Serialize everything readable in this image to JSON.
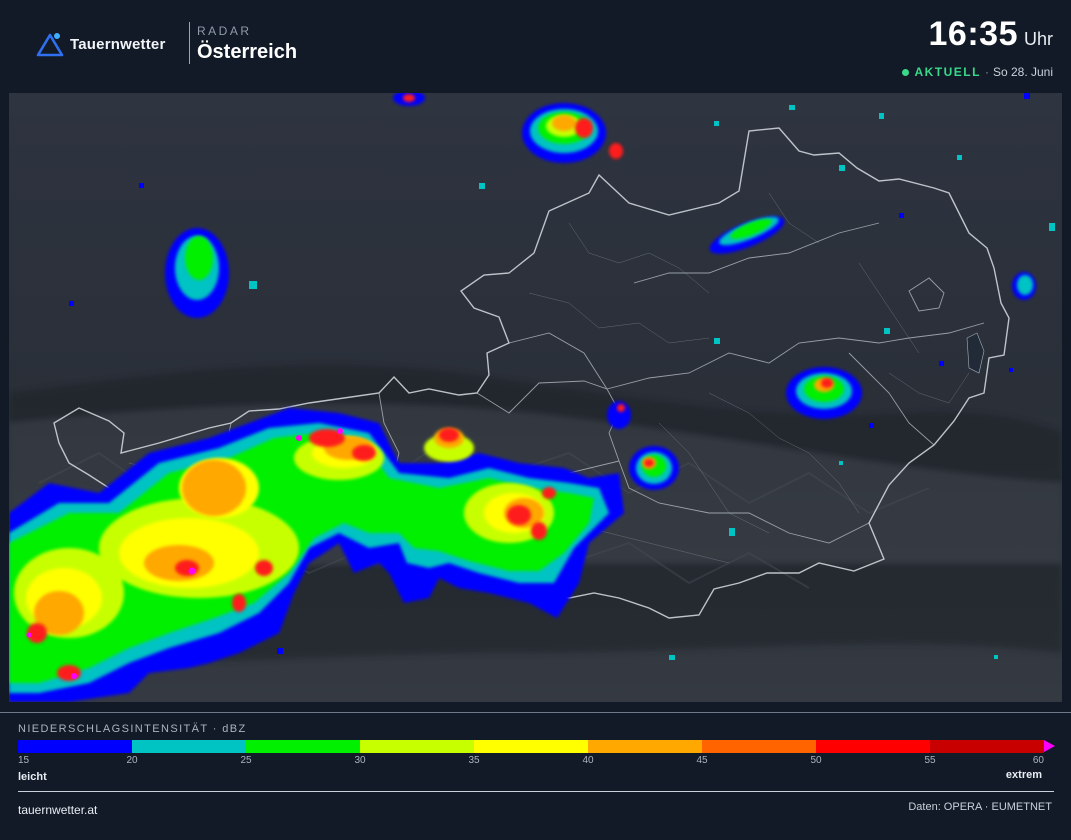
{
  "header": {
    "brand_name": "Tauernwetter",
    "section_kicker": "RADAR",
    "section_title": "Österreich",
    "time": "16:35",
    "time_unit": "Uhr",
    "status_live": "AKTUELL",
    "status_sep": "·",
    "status_date": "So 28. Juni"
  },
  "legend": {
    "title": "NIEDERSCHLAGSINTENSITÄT · dBZ",
    "colors": [
      "#0000ff",
      "#00c3c3",
      "#00f000",
      "#c8ff00",
      "#ffff00",
      "#ffa800",
      "#ff6400",
      "#ff0000",
      "#c80000"
    ],
    "arrow_color": "#ff00ff",
    "ticks": [
      "15",
      "20",
      "25",
      "30",
      "35",
      "40",
      "45",
      "50",
      "55",
      "60"
    ],
    "label_low": "leicht",
    "label_high": "extrem"
  },
  "footer": {
    "site": "tauernwetter.at",
    "credits": "Daten: OPERA · EUMETNET"
  }
}
